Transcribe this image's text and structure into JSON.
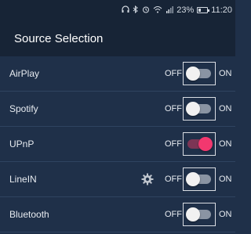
{
  "status_bar": {
    "battery": "23%",
    "time": "11:20"
  },
  "header": {
    "title": "Source Selection"
  },
  "sources": [
    {
      "label": "AirPlay",
      "off": "OFF",
      "on": "ON",
      "enabled": false,
      "settings": false
    },
    {
      "label": "Spotify",
      "off": "OFF",
      "on": "ON",
      "enabled": false,
      "settings": false
    },
    {
      "label": "UPnP",
      "off": "OFF",
      "on": "ON",
      "enabled": true,
      "settings": false
    },
    {
      "label": "LineIN",
      "off": "OFF",
      "on": "ON",
      "enabled": false,
      "settings": true
    },
    {
      "label": "Bluetooth",
      "off": "OFF",
      "on": "ON",
      "enabled": false,
      "settings": false
    }
  ],
  "colors": {
    "background": "#1f3049",
    "header": "#172436",
    "toggle_on": "#f2386f",
    "toggle_off_track": "#8a94a3"
  },
  "icons": [
    "headphones-icon",
    "bluetooth-icon",
    "alarm-icon",
    "wifi-icon",
    "signal-icon",
    "battery-icon",
    "gear-icon"
  ]
}
